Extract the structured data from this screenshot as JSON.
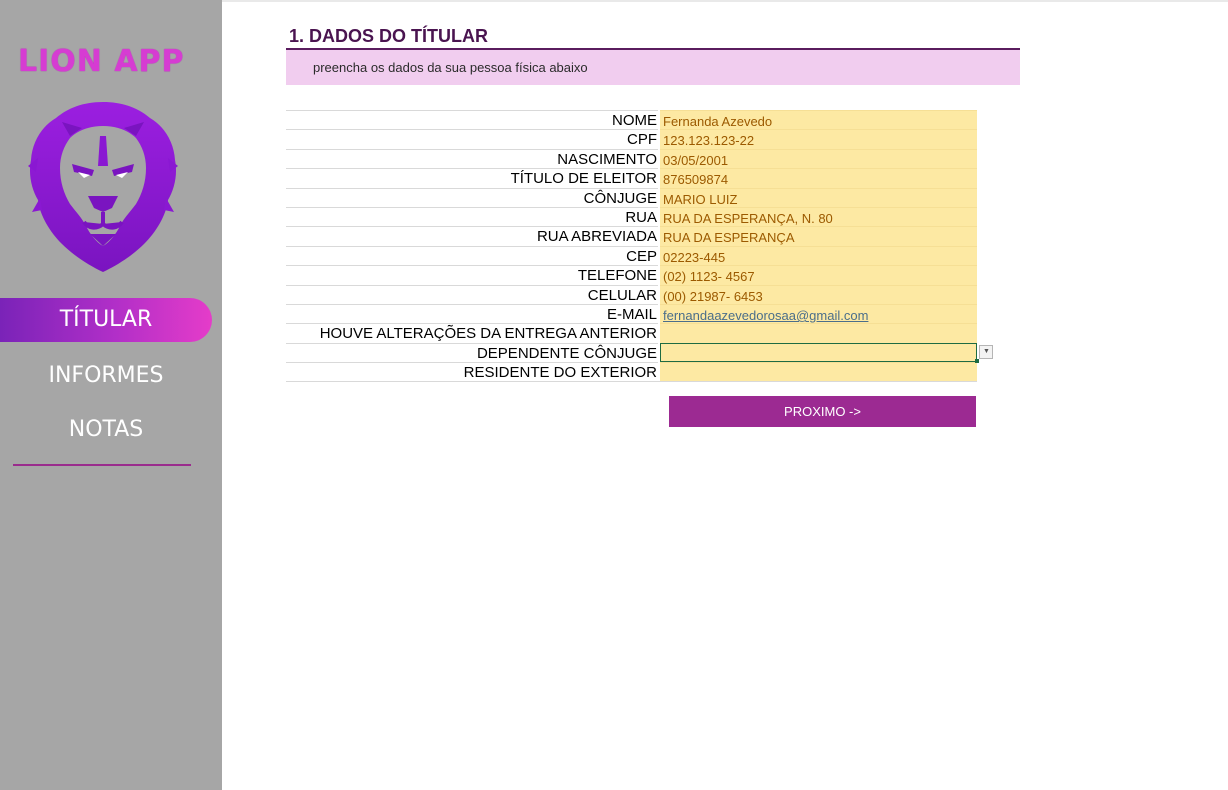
{
  "app": {
    "logo_text": "LION APP"
  },
  "sidebar": {
    "items": [
      {
        "label": "TÍTULAR",
        "active": true
      },
      {
        "label": "INFORMES",
        "active": false
      },
      {
        "label": "NOTAS",
        "active": false
      }
    ]
  },
  "main": {
    "title": "1. DADOS DO TÍTULAR",
    "subtitle": "preencha os dados da sua pessoa física abaixo",
    "fields": [
      {
        "label": "NOME",
        "value": "Fernanda Azevedo"
      },
      {
        "label": "CPF",
        "value": "123.123.123-22"
      },
      {
        "label": "NASCIMENTO",
        "value": "03/05/2001"
      },
      {
        "label": "TÍTULO DE ELEITOR",
        "value": "876509874"
      },
      {
        "label": "CÔNJUGE",
        "value": "MARIO LUIZ"
      },
      {
        "label": "RUA",
        "value": "RUA DA ESPERANÇA, N. 80"
      },
      {
        "label": "RUA ABREVIADA",
        "value": "RUA DA ESPERANÇA"
      },
      {
        "label": "CEP",
        "value": "02223-445"
      },
      {
        "label": "TELEFONE",
        "value": "(02) 1123- 4567"
      },
      {
        "label": "CELULAR",
        "value": "(00) 21987- 6453"
      },
      {
        "label": "E-MAIL",
        "value": "fernandaazevedorosaa@gmail.com"
      },
      {
        "label": "HOUVE ALTERAÇÕES DA ENTREGA ANTERIOR",
        "value": ""
      },
      {
        "label": "DEPENDENTE CÔNJUGE",
        "value": ""
      },
      {
        "label": "RESIDENTE DO EXTERIOR",
        "value": ""
      }
    ],
    "next_button": "PROXIMO ->"
  },
  "colors": {
    "sidebar_bg": "#a6a6a6",
    "accent": "#9c2a92",
    "field_bg": "#fde9a3",
    "subtitle_bg": "#f1cdef"
  }
}
